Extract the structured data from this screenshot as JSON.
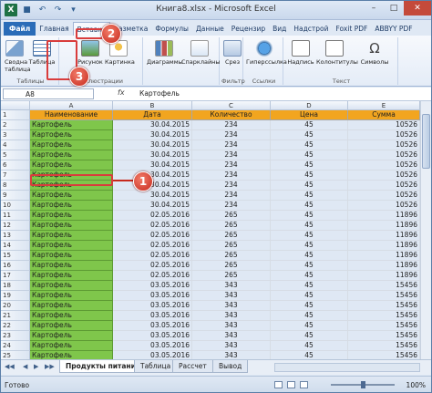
{
  "window": {
    "title": "Книга8.xlsx - Microsoft Excel",
    "app_icon": "X"
  },
  "ribbon_tabs": [
    "Файл",
    "Главная",
    "Вставка",
    "Разметка",
    "Формулы",
    "Данные",
    "Рецензир",
    "Вид",
    "Надстрой",
    "Foxit PDF",
    "ABBYY PDF"
  ],
  "ribbon": {
    "groups": {
      "tables": "Таблицы",
      "illustrations": "Иллюстрации",
      "filter": "Фильтр",
      "links": "Ссылки",
      "text": "Текст"
    },
    "buttons": {
      "pivot": "Сводна таблица",
      "table": "Таблица",
      "picture": "Рисунок",
      "clipart": "Картинка",
      "charts": "Диаграммы",
      "sparklines": "Спарклайны",
      "slicer": "Срез",
      "hyperlink": "Гиперссылка",
      "textbox": "Надпись",
      "headers": "Колонтитулы",
      "symbols": "Символы"
    }
  },
  "formula_bar": {
    "name_box": "A8",
    "fx": "fx",
    "content": "Картофель"
  },
  "columns": [
    "A",
    "B",
    "C",
    "D",
    "E"
  ],
  "table": {
    "headers": [
      "Наименование",
      "Дата",
      "Количество",
      "Цена",
      "Сумма"
    ],
    "rows": [
      [
        "Картофель",
        "30.04.2015",
        "234",
        "45",
        "10526"
      ],
      [
        "Картофель",
        "30.04.2015",
        "234",
        "45",
        "10526"
      ],
      [
        "Картофель",
        "30.04.2015",
        "234",
        "45",
        "10526"
      ],
      [
        "Картофель",
        "30.04.2015",
        "234",
        "45",
        "10526"
      ],
      [
        "Картофель",
        "30.04.2015",
        "234",
        "45",
        "10526"
      ],
      [
        "Картофель",
        "30.04.2015",
        "234",
        "45",
        "10526"
      ],
      [
        "Картофель",
        "30.04.2015",
        "234",
        "45",
        "10526"
      ],
      [
        "Картофель",
        "30.04.2015",
        "234",
        "45",
        "10526"
      ],
      [
        "Картофель",
        "30.04.2015",
        "234",
        "45",
        "10526"
      ],
      [
        "Картофель",
        "02.05.2016",
        "265",
        "45",
        "11896"
      ],
      [
        "Картофель",
        "02.05.2016",
        "265",
        "45",
        "11896"
      ],
      [
        "Картофель",
        "02.05.2016",
        "265",
        "45",
        "11896"
      ],
      [
        "Картофель",
        "02.05.2016",
        "265",
        "45",
        "11896"
      ],
      [
        "Картофель",
        "02.05.2016",
        "265",
        "45",
        "11896"
      ],
      [
        "Картофель",
        "02.05.2016",
        "265",
        "45",
        "11896"
      ],
      [
        "Картофель",
        "02.05.2016",
        "265",
        "45",
        "11896"
      ],
      [
        "Картофель",
        "03.05.2016",
        "343",
        "45",
        "15456"
      ],
      [
        "Картофель",
        "03.05.2016",
        "343",
        "45",
        "15456"
      ],
      [
        "Картофель",
        "03.05.2016",
        "343",
        "45",
        "15456"
      ],
      [
        "Картофель",
        "03.05.2016",
        "343",
        "45",
        "15456"
      ],
      [
        "Картофель",
        "03.05.2016",
        "343",
        "45",
        "15456"
      ],
      [
        "Картофель",
        "03.05.2016",
        "343",
        "45",
        "15456"
      ],
      [
        "Картофель",
        "03.05.2016",
        "343",
        "45",
        "15456"
      ],
      [
        "Картофель",
        "03.05.2016",
        "343",
        "45",
        "15456"
      ]
    ]
  },
  "sheet_tabs": [
    "Продукты питания",
    "Таблица",
    "Рассчет",
    "Вывод"
  ],
  "status": {
    "text": "Готово",
    "zoom": "100%"
  },
  "callouts": [
    "1",
    "2",
    "3"
  ],
  "colors": {
    "header_fill": "#f2a51f",
    "name_fill": "#7fc64b",
    "callout": "#c7291d"
  }
}
